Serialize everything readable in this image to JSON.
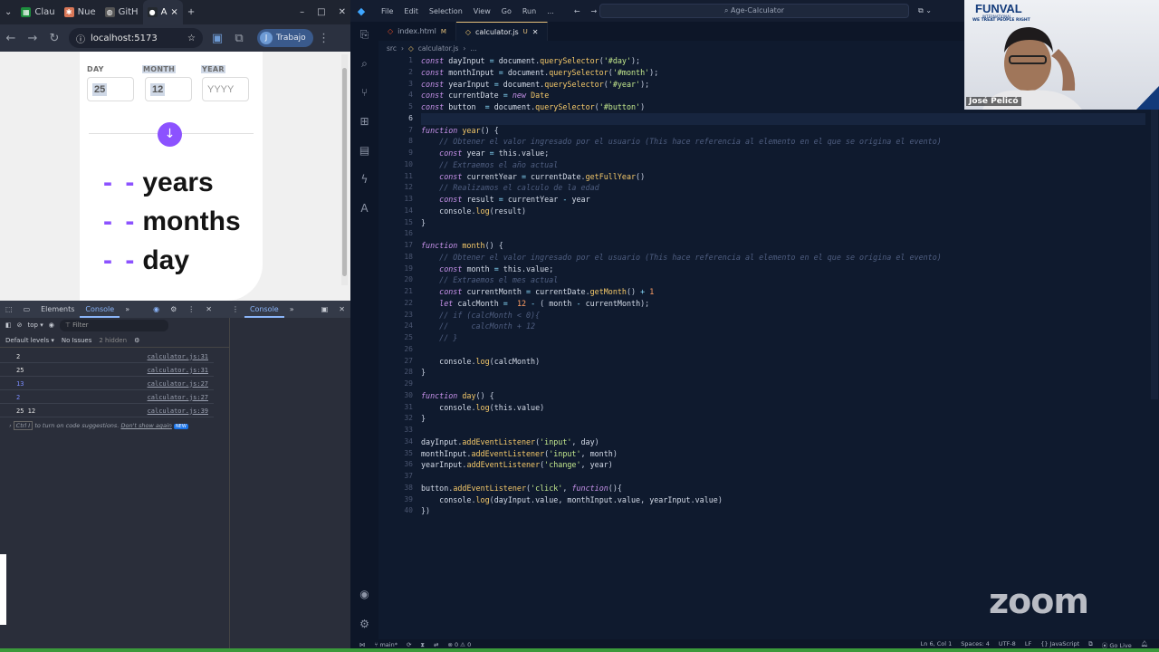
{
  "browser": {
    "tabs": [
      {
        "label": "Clau",
        "icon": "spreadsheet-icon",
        "color": "#1e8e3e"
      },
      {
        "label": "Nue",
        "icon": "claude-icon",
        "color": "#d97757"
      },
      {
        "label": "GitH",
        "icon": "globe-icon",
        "color": "#9aa0ab"
      },
      {
        "label": "A",
        "icon": "github-icon",
        "color": "#24292f"
      }
    ],
    "url": "localhost:5173",
    "profile_label": "Trabajo",
    "new_tab": "+"
  },
  "app": {
    "day_label": "DAY",
    "month_label": "MONTH",
    "year_label": "YEAR",
    "day_value": "25",
    "month_value": "12",
    "year_placeholder": "YYYY",
    "result_years": "years",
    "result_months": "months",
    "result_days": "day",
    "dash": "- -",
    "accent": "#8c52ff"
  },
  "devtools": {
    "tabs": [
      "Elements",
      "Console"
    ],
    "secondary_tab": "Console",
    "context": "top",
    "filter_placeholder": "Filter",
    "levels": "Default levels",
    "issues": "No Issues",
    "hidden": "2 hidden",
    "logs": [
      {
        "value": "2",
        "source": "calculator.js:31",
        "blue": false
      },
      {
        "value": "25",
        "source": "calculator.js:31",
        "blue": false
      },
      {
        "value": "13",
        "source": "calculator.js:27",
        "blue": true
      },
      {
        "value": "2",
        "source": "calculator.js:27",
        "blue": true
      },
      {
        "value": "25 12",
        "source": "calculator.js:39",
        "blue": false
      }
    ],
    "tip_pre": "Ctrl I",
    "tip_text": "to turn on code suggestions.",
    "tip_link": "Don't show again",
    "tip_badge": "NEW"
  },
  "vscode": {
    "menus": [
      "File",
      "Edit",
      "Selection",
      "View",
      "Go",
      "Run",
      "..."
    ],
    "search": "Age-Calculator",
    "tabs": [
      {
        "label": "index.html",
        "mark": "M"
      },
      {
        "label": "calculator.js",
        "mark": "U"
      }
    ],
    "breadcrumb": [
      "src",
      "calculator.js",
      "..."
    ],
    "status": {
      "branch": "main*",
      "errors": "0",
      "warnings": "0",
      "position": "Ln 6, Col 1",
      "spaces": "Spaces: 4",
      "encoding": "UTF-8",
      "eol": "LF",
      "language": "JavaScript",
      "live": "Go Live"
    }
  },
  "overlay": {
    "brand": "FUNVAL",
    "brand_sub": "INTERNATIONAL",
    "tagline": "WE TREAT PEOPLE RIGHT",
    "presenter": "José Pelicó",
    "zoom": "zoom"
  }
}
